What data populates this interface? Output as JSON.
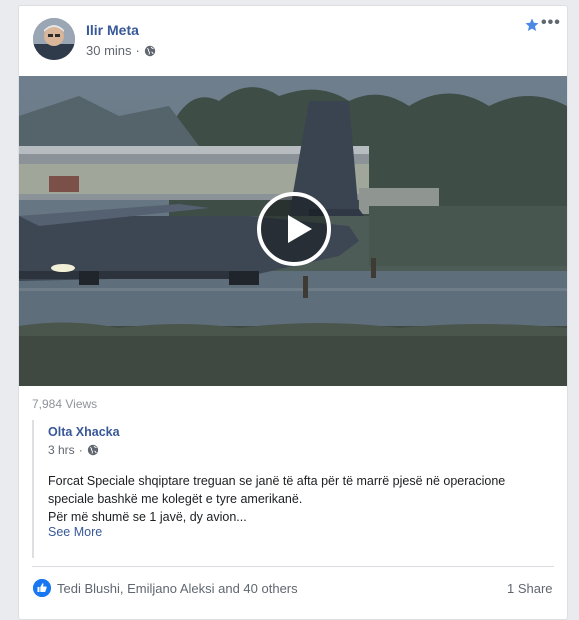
{
  "post": {
    "author": "Ilir Meta",
    "time": "30 mins",
    "privacy_icon": "globe-icon",
    "star_icon": "star-icon",
    "more_label": "•••"
  },
  "video": {
    "play_icon": "play-icon"
  },
  "views": "7,984 Views",
  "shared_post": {
    "author": "Olta Xhacka",
    "time": "3 hrs",
    "text_line1": "Forcat Speciale shqiptare treguan se janë të afta për të marrë pjesë në operacione",
    "text_line2": "speciale bashkë me kolegët e tyre amerikanë.",
    "text_line3": "Për më shumë se 1 javë, dy avion...",
    "see_more": "See More"
  },
  "footer": {
    "reactions": "Tedi Blushi, Emiljano Aleksi and 40 others",
    "share": "1 Share",
    "like_icon": "like-icon"
  },
  "colors": {
    "link": "#385898",
    "like": "#1877f2",
    "background": "#e9ebee"
  }
}
